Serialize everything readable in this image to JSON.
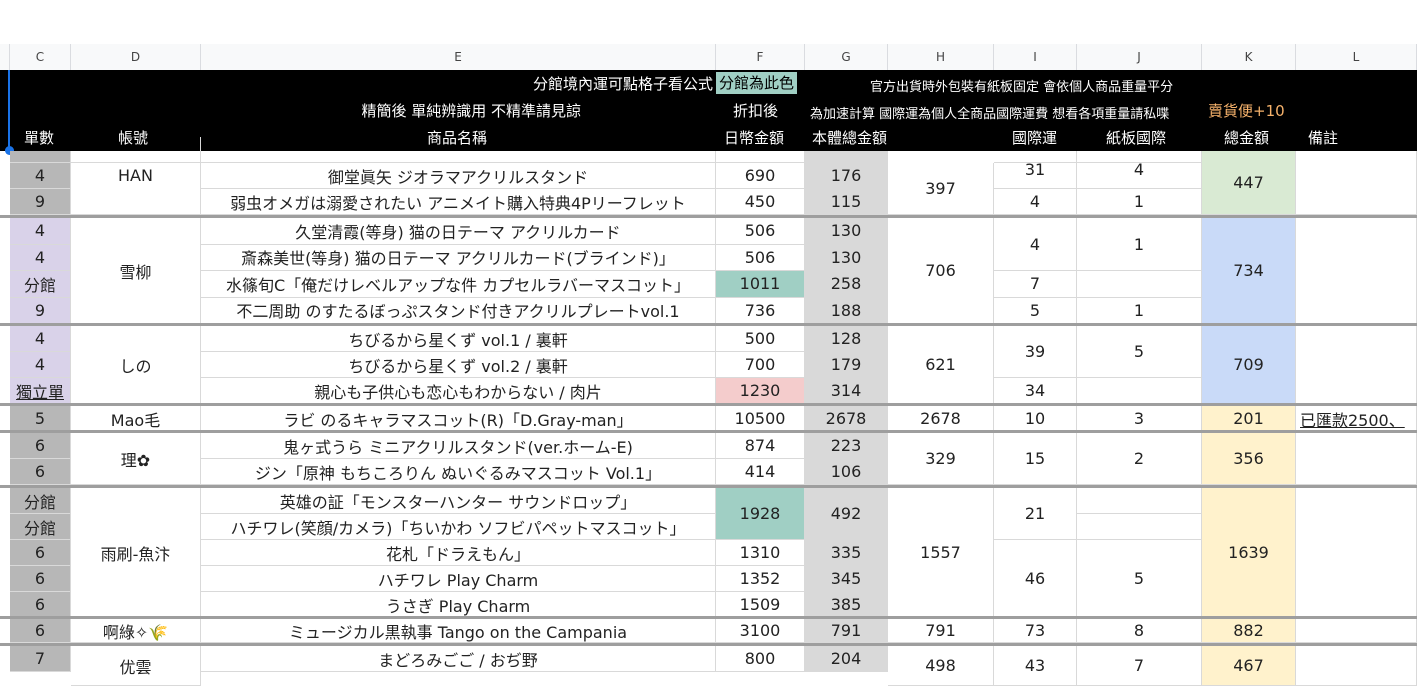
{
  "columns": [
    "C",
    "D",
    "E",
    "F",
    "G",
    "H",
    "I",
    "J",
    "K",
    "L"
  ],
  "header": {
    "row1_e": "分館境內運可點格子看公式",
    "row1_f": "分館為此色",
    "row1_hj": "官方出貨時外包裝有紙板固定 會依個人商品重量平分",
    "row2_e": "精簡後 單純辨識用 不精準請見諒",
    "row2_f": "折扣後",
    "row2_hj": "為加速計算 國際運為個人全商品國際運費 想看各項重量請私喋",
    "row2_k": "賣貨便+10",
    "row3": [
      "單數",
      "帳號",
      "商品名稱",
      "日幣金額",
      "本體總金額",
      "",
      "國際運",
      "紙板國際",
      "總金額",
      "備註"
    ]
  },
  "colors": {
    "purple": "#d9d2e9",
    "gray": "#b7b7b7",
    "teal": "#a0cfc4",
    "pink": "#f4cccc",
    "green": "#d9ead3",
    "blue": "#c9daf8",
    "yellow": "#fff2cc",
    "gcol": "#d9d9d9"
  },
  "cells": {
    "r0_e": "御堂眞矢 ジオラマアクリルスタンド",
    "r0_f": "690",
    "r0_g": "176",
    "r1_e": "弱虫オメガは溺愛されたい アニメイト購入特典4Pリーフレット",
    "r1_f": "450",
    "r1_g": "115",
    "r0_c": "4",
    "r1_c": "9",
    "han": "HAN",
    "han_h": "397",
    "han_i1": "31",
    "han_j1": "4",
    "han_i2": "4",
    "han_j2": "1",
    "han_k": "447",
    "s_c": [
      "4",
      "4",
      "分館",
      "9"
    ],
    "s_e": [
      "久堂清霞(等身) 猫の日テーマ アクリルカード",
      "斎森美世(等身) 猫の日テーマ アクリルカード(ブラインド)」",
      "水篠旬C「俺だけレベルアップな件 カプセルラバーマスコット」",
      "不二周助 のすたるぼっぷスタンド付きアクリルプレートvol.1"
    ],
    "s_f": [
      "506",
      "506",
      "1011",
      "736"
    ],
    "s_g": [
      "130",
      "130",
      "258",
      "188"
    ],
    "snow": "雪柳",
    "snow_h": "706",
    "snow_i1": "4",
    "snow_j1": "1",
    "snow_i2": "7",
    "snow_i3": "5",
    "snow_j3": "1",
    "snow_k": "734",
    "n_c": [
      "4",
      "4",
      "獨立單"
    ],
    "n_e": [
      "ちびるから星くず vol.1 / 裏軒",
      "ちびるから星くず vol.2 / 裏軒",
      "親心も子供心も恋心もわからない / 肉片"
    ],
    "n_f": [
      "500",
      "700",
      "1230"
    ],
    "n_g": [
      "128",
      "179",
      "314"
    ],
    "shino": "しの",
    "shino_h": "621",
    "shino_i1": "39",
    "shino_j1": "5",
    "shino_i2": "34",
    "shino_k": "709",
    "m_c": "5",
    "m_d": "Mao毛",
    "m_e": "ラビ のるキャラマスコット(R)「D.Gray-man」",
    "m_f": "10500",
    "m_g": "2678",
    "m_h": "2678",
    "m_i": "10",
    "m_j": "3",
    "m_k": "201",
    "m_l": "已匯款2500、",
    "ri_c": [
      "6",
      "6"
    ],
    "ri_d": "理✿",
    "ri_e": [
      "鬼ヶ式うら ミニアクリルスタンド(ver.ホーム-E)",
      "ジン「原神 もちころりん ぬいぐるみマスコット Vol.1」"
    ],
    "ri_f": [
      "874",
      "414"
    ],
    "ri_g": [
      "223",
      "106"
    ],
    "ri_h": "329",
    "ri_i": "15",
    "ri_j": "2",
    "ri_k": "356",
    "u_c": [
      "分館",
      "分館",
      "6",
      "6",
      "6"
    ],
    "u_d": "雨刷-魚汴",
    "u_e": [
      "英雄の証「モンスターハンター サウンドロップ」",
      "ハチワレ(笑顔/カメラ)「ちいかわ ソフビパペットマスコット」",
      "花札「ドラえもん」",
      "ハチワレ Play Charm",
      "うさぎ Play Charm"
    ],
    "u_f12": "1928",
    "u_f": [
      "1310",
      "1352",
      "1509"
    ],
    "u_g12": "492",
    "u_g": [
      "335",
      "345",
      "385"
    ],
    "u_h": "1557",
    "u_i1": "21",
    "u_i2": "46",
    "u_j2": "5",
    "u_k": "1639",
    "a_c": "6",
    "a_d": "啊綠✧🌾",
    "a_e": "ミュージカル黒執事 Tango on the Campania",
    "a_f": "3100",
    "a_g": "791",
    "a_h": "791",
    "a_i": "73",
    "a_j": "8",
    "a_k": "882",
    "z_c": "7",
    "z_d": "优雲",
    "z_e": "まどろみごご / おぢ野",
    "z_f": "800",
    "z_g": "204",
    "z_h": "498",
    "z_i": "43",
    "z_j": "7",
    "z_k": "467"
  }
}
